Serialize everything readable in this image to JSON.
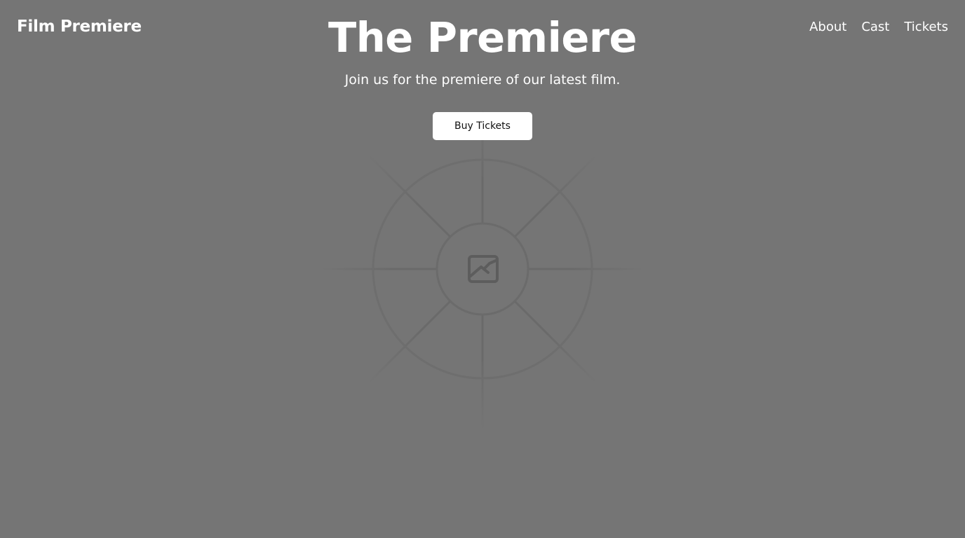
{
  "header": {
    "brand": "Film Premiere",
    "nav": [
      {
        "label": "About"
      },
      {
        "label": "Cast"
      },
      {
        "label": "Tickets"
      }
    ]
  },
  "hero": {
    "title": "The Premiere",
    "subtitle": "Join us for the premiere of our latest film.",
    "cta_label": "Buy Tickets",
    "media_icon": "image-icon"
  },
  "colors": {
    "background": "#757575",
    "text": "#ffffff",
    "button_background": "#ffffff",
    "button_text": "#111111"
  }
}
